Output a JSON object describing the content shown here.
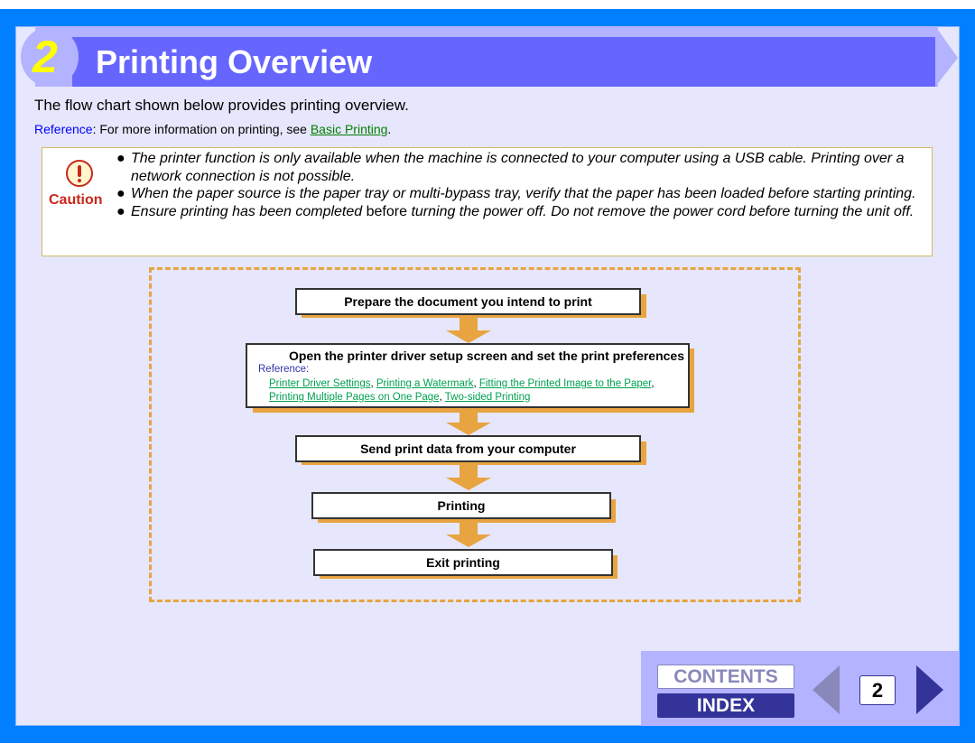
{
  "header": {
    "chapter_number": "2",
    "title": "Printing Overview"
  },
  "intro": {
    "text": "The flow chart shown below provides printing overview.",
    "reference_label": "Reference",
    "reference_text": ": For more information on printing, see ",
    "reference_link": "Basic Printing",
    "reference_end": "."
  },
  "caution": {
    "label": "Caution",
    "icon": "exclamation-circle-icon",
    "items": [
      {
        "text": "The printer function is only available when the machine is connected to your computer using a USB cable. Printing over a network connection is not possible."
      },
      {
        "text": "When the paper source is the paper tray or multi-bypass tray, verify that the paper has been loaded before starting printing."
      },
      {
        "part1": "Ensure printing has been completed",
        "part2": " before ",
        "part3": "turning the power off. Do not remove the power cord before turning the unit off."
      }
    ]
  },
  "flowchart": {
    "steps": [
      {
        "label": "Prepare the document you intend to print"
      },
      {
        "label": "Open the printer driver setup screen and set the print preferences",
        "reference_label": "Reference:",
        "links": [
          "Printer Driver Settings",
          "Printing a Watermark",
          "Fitting the Printed Image to the Paper",
          "Printing Multiple Pages on One Page",
          "Two-sided Printing"
        ]
      },
      {
        "label": "Send print data from your computer"
      },
      {
        "label": "Printing"
      },
      {
        "label": "Exit printing"
      }
    ]
  },
  "nav": {
    "contents_label": "CONTENTS",
    "index_label": "INDEX",
    "page_number": "2",
    "prev_icon": "triangle-left-icon",
    "next_icon": "triangle-right-icon"
  },
  "colors": {
    "frame": "#0080ff",
    "page_bg": "#e6e6fc",
    "header_light": "#b3b3ff",
    "header_dark": "#6666ff",
    "chapter_number": "#ffff00",
    "accent_orange": "#e8a440",
    "caution_red": "#c8281c",
    "link_green": "#008000",
    "nav_dark": "#333399"
  }
}
